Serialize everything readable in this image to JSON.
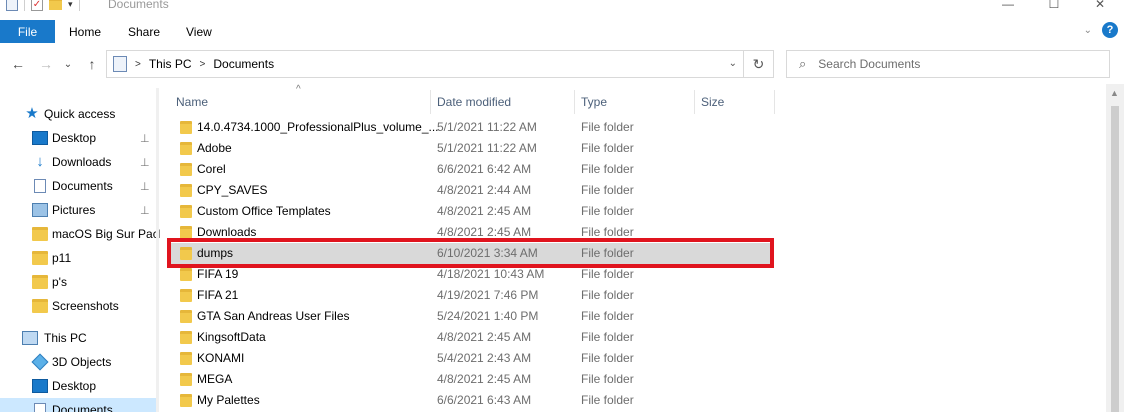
{
  "window": {
    "title": "Documents",
    "minimize": "—",
    "maximize": "☐",
    "close": "✕"
  },
  "ribbon": {
    "tabs": [
      "File",
      "Home",
      "Share",
      "View"
    ],
    "expand_icon": "⌄",
    "help_icon": "?"
  },
  "nav": {
    "back": "←",
    "forward": "→",
    "recent": "⌄",
    "up": "↑",
    "breadcrumb": [
      "This PC",
      "Documents"
    ],
    "dropdown": "⌄",
    "refresh": "↻"
  },
  "search": {
    "icon": "⌕",
    "placeholder": "Search Documents"
  },
  "sidebar": {
    "items": [
      {
        "label": "Quick access",
        "icon": "star-icon",
        "pinned": false
      },
      {
        "label": "Desktop",
        "icon": "desktop-icon",
        "pinned": true
      },
      {
        "label": "Downloads",
        "icon": "download-icon",
        "pinned": true
      },
      {
        "label": "Documents",
        "icon": "documents-icon",
        "pinned": true
      },
      {
        "label": "Pictures",
        "icon": "pictures-icon",
        "pinned": true
      },
      {
        "label": "macOS Big Sur Pack",
        "icon": "folder-icon",
        "pinned": false
      },
      {
        "label": "p11",
        "icon": "folder-icon",
        "pinned": false
      },
      {
        "label": "p's",
        "icon": "folder-icon",
        "pinned": false
      },
      {
        "label": "Screenshots",
        "icon": "folder-icon",
        "pinned": false
      },
      {
        "label": "This PC",
        "icon": "computer-icon",
        "pinned": false
      },
      {
        "label": "3D Objects",
        "icon": "3d-objects-icon",
        "pinned": false
      },
      {
        "label": "Desktop",
        "icon": "desktop-icon",
        "pinned": false
      },
      {
        "label": "Documents",
        "icon": "documents-icon",
        "pinned": false
      }
    ],
    "pin_glyph": "📌"
  },
  "columns": {
    "name": "Name",
    "date": "Date modified",
    "type": "Type",
    "size": "Size",
    "sort_glyph": "^"
  },
  "files": [
    {
      "name": "14.0.4734.1000_ProfessionalPlus_volume_...",
      "date": "5/1/2021 11:22 AM",
      "type": "File folder"
    },
    {
      "name": "Adobe",
      "date": "5/1/2021 11:22 AM",
      "type": "File folder"
    },
    {
      "name": "Corel",
      "date": "6/6/2021 6:42 AM",
      "type": "File folder"
    },
    {
      "name": "CPY_SAVES",
      "date": "4/8/2021 2:44 AM",
      "type": "File folder"
    },
    {
      "name": "Custom Office Templates",
      "date": "4/8/2021 2:45 AM",
      "type": "File folder"
    },
    {
      "name": "Downloads",
      "date": "4/8/2021 2:45 AM",
      "type": "File folder"
    },
    {
      "name": "dumps",
      "date": "6/10/2021 3:34 AM",
      "type": "File folder"
    },
    {
      "name": "FIFA 19",
      "date": "4/18/2021 10:43 AM",
      "type": "File folder"
    },
    {
      "name": "FIFA 21",
      "date": "4/19/2021 7:46 PM",
      "type": "File folder"
    },
    {
      "name": "GTA San Andreas User Files",
      "date": "5/24/2021 1:40 PM",
      "type": "File folder"
    },
    {
      "name": "KingsoftData",
      "date": "4/8/2021 2:45 AM",
      "type": "File folder"
    },
    {
      "name": "KONAMI",
      "date": "5/4/2021 2:43 AM",
      "type": "File folder"
    },
    {
      "name": "MEGA",
      "date": "4/8/2021 2:45 AM",
      "type": "File folder"
    },
    {
      "name": "My Palettes",
      "date": "6/6/2021 6:43 AM",
      "type": "File folder"
    }
  ],
  "selected_file": "dumps",
  "colors": {
    "accent": "#1979ca",
    "highlight_border": "#e0141e",
    "selected_row": "#d9d9d9",
    "sidebar_selected": "#cce8ff",
    "folder": "#f2c94c"
  }
}
